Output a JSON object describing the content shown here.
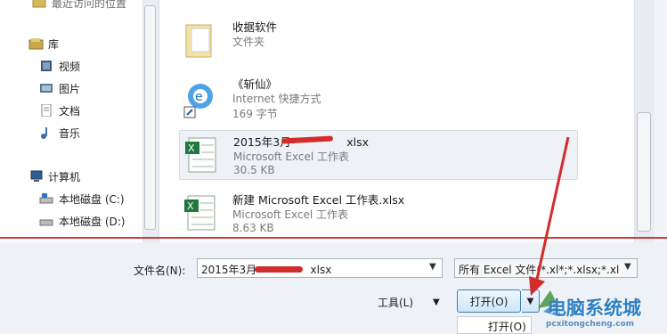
{
  "nav": {
    "items": [
      {
        "label": "最近访问的位置",
        "icon": "recent-places-icon"
      },
      {
        "label": "库",
        "icon": "library-icon"
      },
      {
        "label": "视频",
        "icon": "video-icon"
      },
      {
        "label": "图片",
        "icon": "picture-icon"
      },
      {
        "label": "文档",
        "icon": "document-icon"
      },
      {
        "label": "音乐",
        "icon": "music-icon"
      },
      {
        "label": "计算机",
        "icon": "computer-icon"
      },
      {
        "label": "本地磁盘 (C:)",
        "icon": "drive-icon"
      },
      {
        "label": "本地磁盘 (D:)",
        "icon": "drive-icon"
      }
    ]
  },
  "files": [
    {
      "name": "收据软件",
      "type": "文件夹",
      "size": "",
      "icon": "folder-icon"
    },
    {
      "name": "《斩仙》",
      "type": "Internet 快捷方式",
      "size": "169 字节",
      "icon": "ie-shortcut-icon"
    },
    {
      "name": "2015年3月-",
      "name_suffix": "xlsx",
      "type": "Microsoft Excel 工作表",
      "size": "30.5 KB",
      "icon": "excel-file-icon",
      "selected": true
    },
    {
      "name": "新建 Microsoft Excel 工作表.xlsx",
      "type": "Microsoft Excel 工作表",
      "size": "8.63 KB",
      "icon": "excel-file-icon"
    }
  ],
  "bottom": {
    "filename_label": "文件名(N):",
    "filename_value_prefix": "2015年3月-",
    "filename_value_suffix": "xlsx",
    "filetype_value": "所有 Excel 文件(*.xl*;*.xlsx;*.xl",
    "tools_label": "工具(L)",
    "open_label": "打开(O)",
    "open_menu_item": "打开(O)"
  },
  "watermark": {
    "text": "电脑系统城",
    "url": "pcxitongcheng.com"
  },
  "colors": {
    "annotation_red": "#d23a3a",
    "button_border": "#3c7fb1",
    "watermark_blue": "#2e7fc4"
  }
}
